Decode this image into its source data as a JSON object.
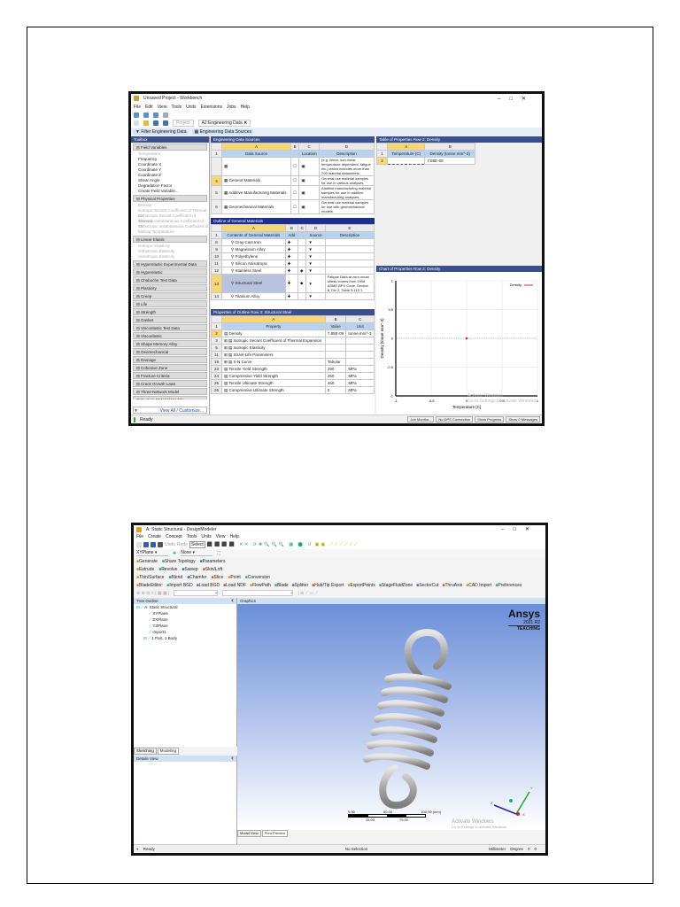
{
  "workbench": {
    "title": "Unsaved Project - Workbench",
    "menu": [
      "File",
      "Edit",
      "View",
      "Tools",
      "Units",
      "Extensions",
      "Jobs",
      "Help"
    ],
    "tabs": [
      "Project",
      "A2:Engineering Data"
    ],
    "filter_buttons": [
      "Filter Engineering Data",
      "Engineering Data Sources"
    ],
    "toolbox": {
      "title": "Toolbox",
      "groups": [
        {
          "label": "Field Variables",
          "items": [
            {
              "t": "Temperature",
              "dim": true
            },
            {
              "t": "Frequency"
            },
            {
              "t": "Coordinate X"
            },
            {
              "t": "Coordinate Y"
            },
            {
              "t": "Coordinate Z"
            },
            {
              "t": "Shear Angle"
            },
            {
              "t": "Degradation Factor"
            },
            {
              "t": "Create Field Variable..."
            }
          ]
        },
        {
          "label": "Physical Properties",
          "items": [
            {
              "t": "Density",
              "dim": true
            },
            {
              "t": "Isotropic Secant Coefficient of Thermal Ex",
              "dim": true
            },
            {
              "t": "Orthotropic Secant Coefficient of Thermal",
              "dim": true
            },
            {
              "t": "Isotropic Instantaneous Coefficient of Th",
              "dim": true
            },
            {
              "t": "Orthotropic Instantaneous Coefficient of",
              "dim": true
            },
            {
              "t": "Melting Temperature",
              "dim": true
            }
          ]
        },
        {
          "label": "Linear Elastic",
          "items": [
            {
              "t": "Isotropic Elasticity",
              "dim": true
            },
            {
              "t": "Orthotropic Elasticity",
              "dim": true
            },
            {
              "t": "Anisotropic Elasticity",
              "dim": true
            }
          ]
        },
        {
          "label": "Hyperelastic Experimental Data",
          "items": []
        },
        {
          "label": "Hyperelastic",
          "items": []
        },
        {
          "label": "Chaboche Test Data",
          "items": []
        },
        {
          "label": "Plasticity",
          "items": []
        },
        {
          "label": "Creep",
          "items": []
        },
        {
          "label": "Life",
          "items": []
        },
        {
          "label": "Strength",
          "items": []
        },
        {
          "label": "Gasket",
          "items": []
        },
        {
          "label": "Viscoelastic Test Data",
          "items": []
        },
        {
          "label": "Viscoelastic",
          "items": []
        },
        {
          "label": "Shape Memory Alloy",
          "items": []
        },
        {
          "label": "Geomechanical",
          "items": []
        },
        {
          "label": "Damage",
          "items": []
        },
        {
          "label": "Cohesive Zone",
          "items": []
        },
        {
          "label": "Fracture Criteria",
          "items": []
        },
        {
          "label": "Crack Growth Laws",
          "items": []
        },
        {
          "label": "Three-Network Model",
          "items": []
        },
        {
          "label": "Custom Material Models",
          "items": []
        }
      ],
      "view_all": "View All / Customize..."
    },
    "sources": {
      "title": "Engineering Data Sources",
      "cols": [
        "A",
        "B",
        "C",
        "D"
      ],
      "headers": [
        "Data Source",
        "",
        "Location",
        "Description"
      ],
      "rows": [
        {
          "n": "",
          "name": "",
          "desc": "(e.g. linear, non-linear, temperature dependent, fatigue etc.) which includes more than 700 material datasheets."
        },
        {
          "n": "4",
          "name": "General Materials",
          "desc": "General use material samples for use in various analyses."
        },
        {
          "n": "5",
          "name": "Additive Manufacturing Materials",
          "desc": "Additive manufacturing material samples for use in additive manufacturing analyses."
        },
        {
          "n": "6",
          "name": "Geomechanical Materials",
          "desc": "General use material samples for use with geomechanical models."
        }
      ]
    },
    "outline": {
      "title": "Outline of General Materials",
      "cols": [
        "A",
        "B",
        "C",
        "D",
        "E"
      ],
      "headers": [
        "Contents of General Materials",
        "Add",
        "",
        "Source",
        "Description"
      ],
      "rows": [
        {
          "n": "8",
          "name": "Gray Cast Iron",
          "desc": ""
        },
        {
          "n": "9",
          "name": "Magnesium Alloy",
          "desc": ""
        },
        {
          "n": "10",
          "name": "Polyethylene",
          "desc": ""
        },
        {
          "n": "11",
          "name": "Silicon Anisotropic",
          "desc": ""
        },
        {
          "n": "12",
          "name": "Stainless Steel",
          "desc": ""
        },
        {
          "n": "13",
          "name": "Structural Steel",
          "desc": "Fatigue Data at zero mean stress comes from 1998 ASME BPV Code, Section 8, Div 2, Table 5-110.1"
        },
        {
          "n": "14",
          "name": "Titanium Alloy",
          "desc": ""
        }
      ]
    },
    "properties": {
      "title": "Properties of Outline Row 3: Structural Steel",
      "cols": [
        "A",
        "B",
        "C"
      ],
      "headers": [
        "Property",
        "Value",
        "Unit"
      ],
      "rows": [
        {
          "n": "2",
          "prop": "Density",
          "value": "7.85E-09",
          "unit": "tonne mm^-3"
        },
        {
          "n": "3",
          "prop": "Isotropic Secant Coefficient of Thermal Expansion",
          "value": "",
          "unit": ""
        },
        {
          "n": "5",
          "prop": "Isotropic Elasticity",
          "value": "",
          "unit": ""
        },
        {
          "n": "11",
          "prop": "Strain-Life Parameters",
          "value": "",
          "unit": ""
        },
        {
          "n": "19",
          "prop": "S-N Curve",
          "value": "Tabular",
          "unit": ""
        },
        {
          "n": "23",
          "prop": "Tensile Yield Strength",
          "value": "250",
          "unit": "MPa"
        },
        {
          "n": "24",
          "prop": "Compressive Yield Strength",
          "value": "250",
          "unit": "MPa"
        },
        {
          "n": "25",
          "prop": "Tensile Ultimate Strength",
          "value": "460",
          "unit": "MPa"
        },
        {
          "n": "26",
          "prop": "Compressive Ultimate Strength",
          "value": "0",
          "unit": "MPa"
        }
      ]
    },
    "table_panel": {
      "title": "Table of Properties Row 2: Density",
      "cols": [
        "A",
        "B"
      ],
      "headers": [
        "Temperature (C)",
        "Density (tonne mm^-3)"
      ],
      "value": "7.85E-09"
    },
    "chart_panel": {
      "title": "Chart of Properties Row 2: Density"
    },
    "status": "Ready",
    "status_buttons": [
      "Job Monitor...",
      "No DPS Connection",
      "Show Progress",
      "Show 0 Messages"
    ],
    "watermark": "Activate Windows",
    "watermark_sub": "Go to Settings to activate Windows."
  },
  "chart_data": {
    "type": "scatter",
    "title": "Chart of Properties Row 2: Density",
    "xlabel": "Temperature [C]",
    "ylabel": "Density [tonne mm^-3]",
    "xlim": [
      -1,
      1
    ],
    "ylim": [
      -1,
      1
    ],
    "xticks": [
      "-1",
      "-0.5",
      "0",
      "0.5",
      "1"
    ],
    "yticks": [
      "1",
      "0.5",
      "0",
      "-0.5",
      "-1"
    ],
    "grid": true,
    "legend": {
      "position": "top-right",
      "entries": [
        "Density"
      ]
    },
    "series": [
      {
        "name": "Density",
        "color": "#e02020",
        "points": [
          [
            0,
            0
          ]
        ]
      }
    ]
  },
  "designmodeler": {
    "title": "A: Static Structural - DesignModeler",
    "menu": [
      "File",
      "Create",
      "Concept",
      "Tools",
      "Units",
      "View",
      "Help"
    ],
    "toolbar1": [
      "Undo",
      "Redo",
      "Select"
    ],
    "plane": "XYPlane",
    "sketch": "None",
    "toolbar3": [
      "Generate",
      "Share Topology",
      "Parameters"
    ],
    "toolbar4": [
      "Extrude",
      "Revolve",
      "Sweep",
      "Skin/Loft"
    ],
    "toolbar5": [
      "Thin/Surface",
      "Blend",
      "Chamfer",
      "Slice",
      "Point",
      "Conversion"
    ],
    "toolbar6": [
      "BladeEditor:",
      "Import BGD",
      "Load BGD",
      "Load NDF",
      "FlowPath",
      "Blade",
      "Splitter",
      "Hub/Tip Export",
      "ExportPoints",
      "StageFluidZone",
      "SectorCut",
      "ThruAxis",
      "CAD Import",
      "Preferences"
    ],
    "tree_title": "Tree Outline",
    "tree": [
      "A: Static Structural",
      "XYPlane",
      "ZXPlane",
      "YZPlane",
      "Import1",
      "1 Part, 1 Body"
    ],
    "left_tabs": [
      "Sketching",
      "Modeling"
    ],
    "details_title": "Details View",
    "graphics_title": "Graphics",
    "logo": "Ansys",
    "version": "2021 R2",
    "edition": "TEACHING",
    "scale": {
      "top": [
        "0.00",
        "50.00",
        "100.00 (mm)"
      ],
      "bottom": [
        "25.00",
        "75.00"
      ]
    },
    "axes": [
      "X",
      "Y",
      "Z"
    ],
    "view_tabs": [
      "Model View",
      "Print Preview"
    ],
    "status": "Ready",
    "selection": "No Selection",
    "units": "Millimeter",
    "angle": "Degree",
    "n1": "0",
    "n2": "0",
    "watermark": "Activate Windows",
    "watermark_sub": "Go to Settings to activate Windows."
  }
}
